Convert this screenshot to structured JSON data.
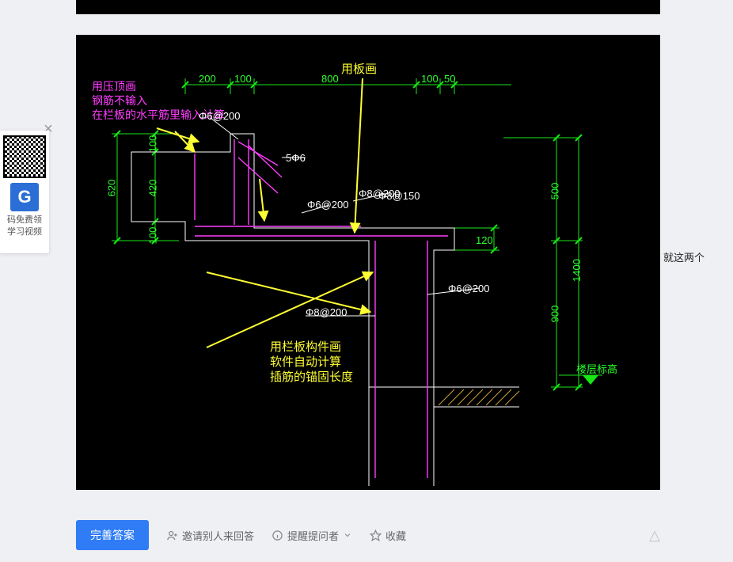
{
  "top_sliver": {
    "present": true
  },
  "qr_panel": {
    "logo_letter": "G",
    "line1": "码免费领",
    "line2": "学习视频",
    "close_glyph": "×"
  },
  "right_text": "就这两个",
  "actions": {
    "primary_label": "完善答案",
    "invite_label": "邀请别人来回答",
    "remind_label": "提醒提问者",
    "favorite_label": "收藏",
    "trailing_icon_glyph": "△"
  },
  "cad": {
    "ann_magenta_l1": "用压顶画",
    "ann_magenta_l2": "钢筋不输入",
    "ann_magenta_l3": "在栏板的水平筋里输入计算",
    "ann_top_yellow": "用板画",
    "ann_mid_yellow_l1": "用栏板构件画",
    "ann_mid_yellow_l2": "软件自动计算",
    "ann_mid_yellow_l3": "插筋的锚固长度",
    "el_label": "楼层标高",
    "dims": {
      "top_200": "200",
      "top_100a": "100",
      "top_800": "800",
      "top_100b": "100",
      "top_50": "50",
      "left_100": "100",
      "left_620": "620",
      "inner_100": "100",
      "inner_420": "420",
      "right_120": "120",
      "right_500": "500",
      "right_1400": "1400",
      "right_900": "900"
    },
    "rebar": {
      "r_5d6": "5Φ6",
      "r_68_200a": "Φ6@200",
      "r_68_200b": "Φ6@200",
      "r_68_200c": "Φ6@200",
      "r_88_200a": "Φ8@200",
      "r_88_200b": "Φ8@200",
      "r_88_150": "Φ8@150"
    }
  }
}
